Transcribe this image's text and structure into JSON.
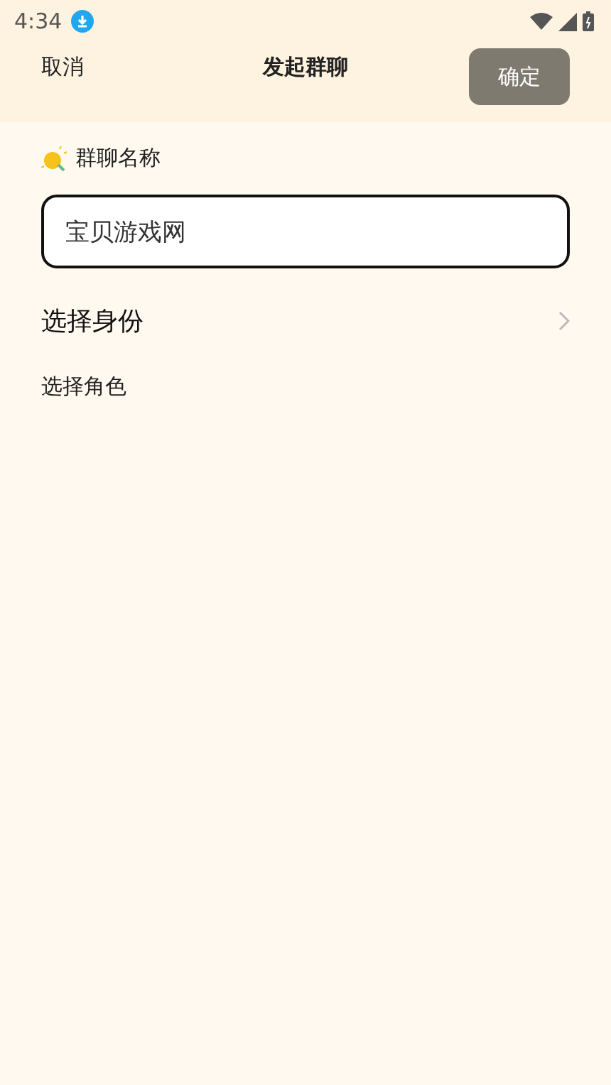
{
  "status_bar": {
    "time": "4:34"
  },
  "header": {
    "cancel": "取消",
    "title": "发起群聊",
    "confirm": "确定"
  },
  "name_field": {
    "label": "群聊名称",
    "value": "宝贝游戏网"
  },
  "identity_row": {
    "label": "选择身份"
  },
  "role_section": {
    "label": "选择角色"
  }
}
